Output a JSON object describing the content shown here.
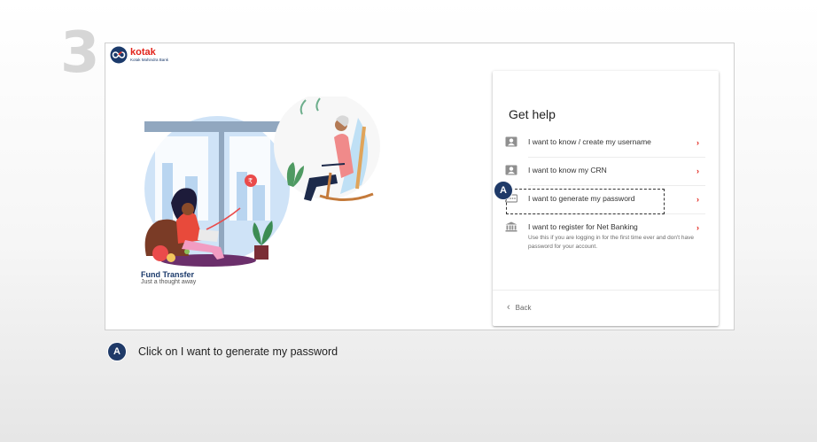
{
  "step": {
    "number": "3"
  },
  "brand": {
    "name": "kotak",
    "subtitle": "Kotak Mahindra Bank",
    "color": "#e2231a",
    "navy": "#1b3a6b"
  },
  "illustration": {
    "title": "Fund Transfer",
    "subtitle": "Just a thought away"
  },
  "help": {
    "title": "Get help",
    "options": [
      {
        "icon": "user-card-icon",
        "label": "I want to know / create my username"
      },
      {
        "icon": "user-card-icon",
        "label": "I want to know my CRN"
      },
      {
        "icon": "password-field-icon",
        "label": "I want to generate my password"
      },
      {
        "icon": "bank-icon",
        "label": "I want to register for Net Banking",
        "description": "Use this if you are logging in for the first time ever and don't have password for your account."
      }
    ],
    "back_label": "Back"
  },
  "annotation": {
    "marker": "A",
    "instruction": "Click on I want to generate  my password"
  }
}
